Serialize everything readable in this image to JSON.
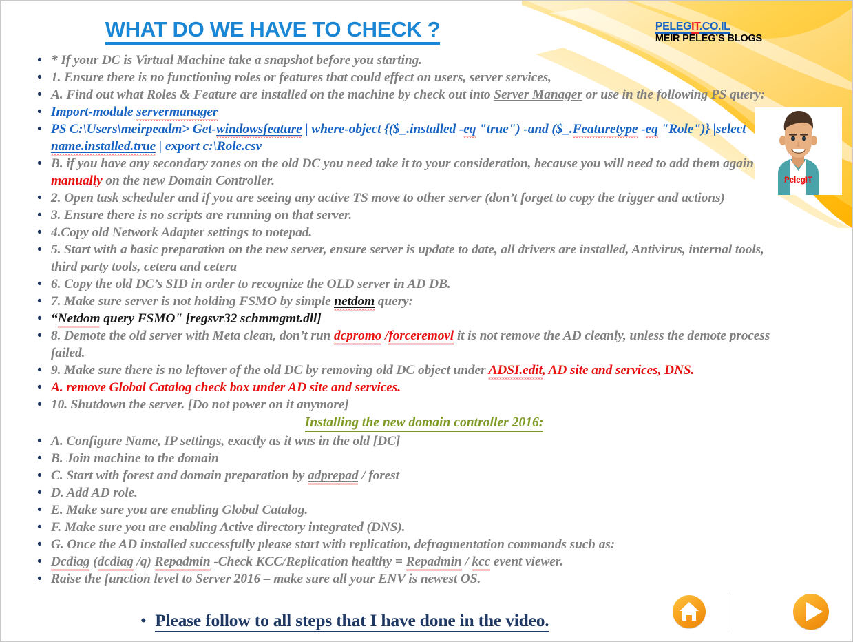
{
  "title": "WHAT DO WE HAVE TO CHECK ?",
  "logo": {
    "part1": "PELEG",
    "part2": "IT",
    "part3": ".CO.IL",
    "subtitle": "MEIR PELEG’S BLOGS"
  },
  "avatar": {
    "shirt_text": "PelegIT",
    "alt": "pelegit-cartoon-avatar"
  },
  "bullet_glyph": "•",
  "colors": {
    "title_blue": "#1b87d4",
    "body_gray": "#808080",
    "accent_red": "#e8110f",
    "code_blue": "#1763c4",
    "heading_green": "#7f9a24",
    "footer_navy": "#1f3864",
    "logo_red": "#e8222a",
    "logo_blue": "#1763c4",
    "swoosh_yellow": "#ffc000",
    "button_orange": "#f5a11b"
  },
  "lines": [
    {
      "id": "line-snapshot",
      "text": "* If your DC is Virtual Machine take a snapshot before you starting."
    },
    {
      "id": "line-item-1",
      "text": "1. Ensure there is no functioning roles or features that could effect on users, server services,"
    },
    {
      "id": "line-item-a-roles",
      "text": "A. Find out what Roles & Feature are installed on the machine by check out into Server Manager or use in the following PS query:"
    },
    {
      "id": "line-ps-import",
      "text": "Import-module servermanager"
    },
    {
      "id": "line-ps-query",
      "text": "PS C:\\Users\\meirpeadm> Get-windowsfeature | where-object {($_.installed -eq \"true\") -and ($_.Featuretype -eq \"Role\")} |select name.installed.true | export c:\\Role.csv"
    },
    {
      "id": "line-item-b-zones",
      "text": "B. if you have any secondary zones on the old DC you need take it to your consideration, because you will need to add them again manually on the new Domain Controller."
    },
    {
      "id": "line-item-2",
      "text": "2. Open task scheduler and if you are seeing any active TS move to other server (don’t forget to copy the trigger and actions)"
    },
    {
      "id": "line-item-3",
      "text": "3. Ensure there is no scripts are running on that server."
    },
    {
      "id": "line-item-4",
      "text": "4.Copy old Network Adapter settings to notepad."
    },
    {
      "id": "line-item-5",
      "text": "5. Start with a basic preparation on the new server, ensure server is update to date, all drivers are installed, Antivirus, internal tools, third party tools, cetera and cetera"
    },
    {
      "id": "line-item-6",
      "text": "6. Copy the old DC’s SID in order to recognize the OLD server in AD DB."
    },
    {
      "id": "line-item-7",
      "text": "7. Make sure server is not holding FSMO by simple netdom query:"
    },
    {
      "id": "line-netdom-cmd",
      "text": "“Netdom query FSMO\" [regsvr32 schmmgmt.dll]"
    },
    {
      "id": "line-item-8",
      "text": "8. Demote the old server with Meta clean, don’t run dcpromo /forceremovl it is not remove the AD cleanly, unless the demote process failed."
    },
    {
      "id": "line-item-9",
      "text": "9. Make sure there is no leftover of the old DC by removing old DC object under ADSI.edit, AD site and services, DNS."
    },
    {
      "id": "line-item-9a",
      "text": "A. remove Global Catalog check box under AD site and services."
    },
    {
      "id": "line-item-10",
      "text": "10. Shutdown the server. [Do not power on it anymore]"
    },
    {
      "id": "line-install-heading",
      "text": " Installing the new domain controller 2016:"
    },
    {
      "id": "line-new-a",
      "text": "A.  Configure Name, IP settings, exactly as it was in the old [DC]"
    },
    {
      "id": "line-new-b",
      "text": "B. Join machine to the domain"
    },
    {
      "id": "line-new-c",
      "text": "C. Start with forest and domain preparation by adprepad / forest"
    },
    {
      "id": "line-new-d",
      "text": "D. Add AD role."
    },
    {
      "id": "line-new-e",
      "text": "E. Make sure you are enabling Global Catalog."
    },
    {
      "id": "line-new-f",
      "text": "F. Make sure you are enabling Active directory integrated (DNS)."
    },
    {
      "id": "line-new-g",
      "text": "G. Once the AD installed successfully please start with replication, defragmentation commands such as:"
    },
    {
      "id": "line-dcdiag",
      "text": "Dcdiag (dcdiag /q) Repadmin -Check KCC/Replication healthy = Repadmin / kcc event viewer."
    },
    {
      "id": "line-raise-level",
      "text": "Raise the function level to Server 2016 – make sure all your ENV is newest OS."
    }
  ],
  "segments": {
    "l1": "* If your DC is Virtual Machine take a snapshot before you starting.",
    "l2": "1. Ensure there is no functioning roles or features that could effect on users, server services,",
    "l3a": "A. Find out what Roles & Feature are installed on the machine by check out into ",
    "l3b": "Server Manager",
    "l3c": " or use in the following PS query:",
    "l4a": "Import-module ",
    "l4b": "servermanager",
    "l5a": "PS C:\\Users\\meirpeadm> Get-",
    "l5b": "windowsfeature",
    "l5c": " | where-object {($_.installed -",
    "l5d": "eq",
    "l5e": " \"true\") -and ($_.",
    "l5f": "Featuretype",
    "l5g": " -",
    "l5h": "eq",
    "l5i": " \"Role\")} |select ",
    "l5j": "name.installed.true",
    "l5k": " | export c:\\Role.csv",
    "l6a": "B. if you have any secondary zones on the old DC you need take it to your consideration, because you will need to add them again ",
    "l6b": "manually",
    "l6c": " on the new Domain Controller.",
    "l7": "2. Open task scheduler and if you are seeing any active TS move to other server (don’t forget to copy the trigger and actions)",
    "l8": "3. Ensure there is no scripts are running on that server.",
    "l9": "4.Copy old Network Adapter settings to notepad.",
    "l10": "5. Start with a basic preparation on the new server, ensure server is update to date, all drivers are installed, Antivirus, internal tools, third party tools, cetera and cetera",
    "l11": "6. Copy the old DC’s SID in order to recognize the OLD server in AD DB.",
    "l12a": "7. Make sure server is not holding FSMO by simple ",
    "l12b": "netdom",
    "l12c": " query:",
    "l13a": "“",
    "l13b": "Netdom",
    "l13c": " query FSMO\" [regsvr32 schmmgmt.dll]",
    "l14a": "8. Demote the old server with Meta clean, don’t run ",
    "l14b": "dcpromo",
    "l14c": " /",
    "l14d": "forceremovl",
    "l14e": " it is not remove the AD cleanly, unless the demote process failed.",
    "l15a": "9. Make sure there is no leftover of the old DC by removing old DC object under ",
    "l15b": "ADSI.edit",
    "l15c": ", AD site and services, DNS.",
    "l16": "A. remove Global Catalog check box under AD site and services.",
    "l17": "10. Shutdown the server. [Do not power on it anymore]",
    "l18": " Installing the new domain controller 2016:",
    "l19": "A.  Configure Name, IP settings, exactly as it was in the old [DC]",
    "l20": "B. Join machine to the domain",
    "l21a": "C. Start with forest and domain preparation by ",
    "l21b": "adprepad",
    "l21c": " / forest",
    "l22": "D. Add AD role.",
    "l23": "E. Make sure you are enabling Global Catalog.",
    "l24": "F. Make sure you are enabling Active directory integrated (DNS).",
    "l25": "G. Once the AD installed successfully please start with replication, defragmentation commands such as:",
    "l26a": "Dcdiag",
    "l26b": " (",
    "l26c": "dcdiag",
    "l26d": " /q) ",
    "l26e": "Repadmin",
    "l26f": " -Check KCC/Replication healthy = ",
    "l26g": "Repadmin",
    "l26h": " / ",
    "l26i": "kcc",
    "l26j": " event viewer.",
    "l27": "Raise the function level to Server 2016 – make sure all your ENV is newest OS."
  },
  "footer": {
    "text": "Please follow to all steps that I have done in the video."
  },
  "nav": {
    "home_label": "home-button",
    "next_label": "next-slide-button"
  }
}
